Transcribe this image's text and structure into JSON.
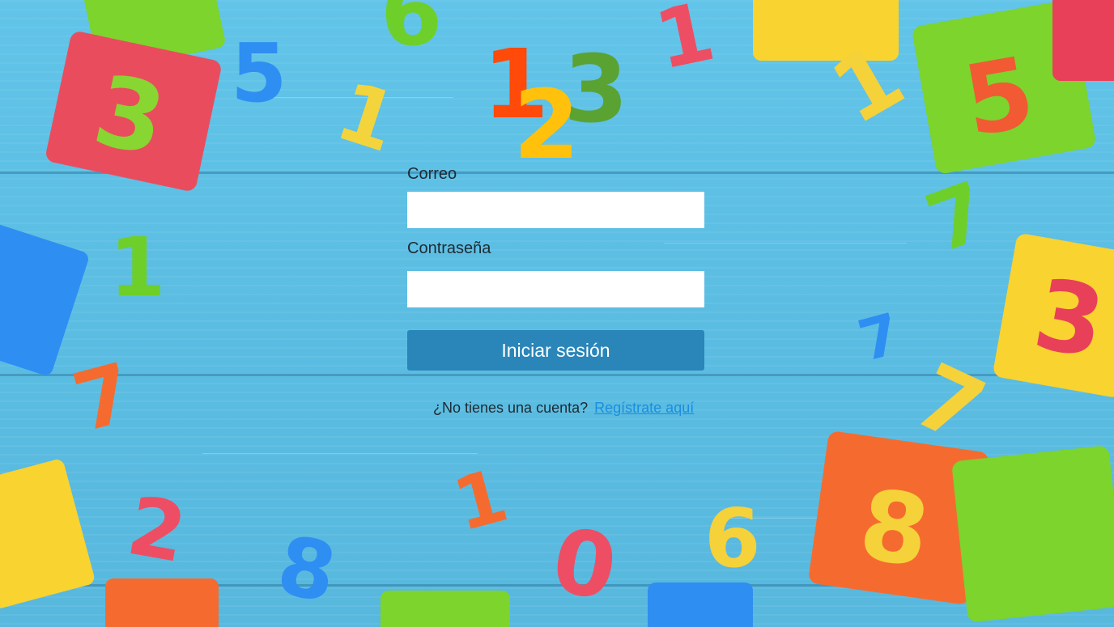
{
  "logo": {
    "digits": [
      "1",
      "2",
      "3"
    ],
    "colors": [
      "#ff4a0a",
      "#ffc10c",
      "#5aa332"
    ]
  },
  "form": {
    "email_label": "Correo",
    "email_value": "",
    "password_label": "Contraseña",
    "password_value": "",
    "submit_label": "Iniciar sesión"
  },
  "footer": {
    "prompt": "¿No tienes una cuenta?",
    "register_link": "Regístrate aquí"
  },
  "colors": {
    "background": "#5cbfe4",
    "button": "#2a86b9",
    "link": "#1a8fe0",
    "text": "#1e2a33"
  }
}
